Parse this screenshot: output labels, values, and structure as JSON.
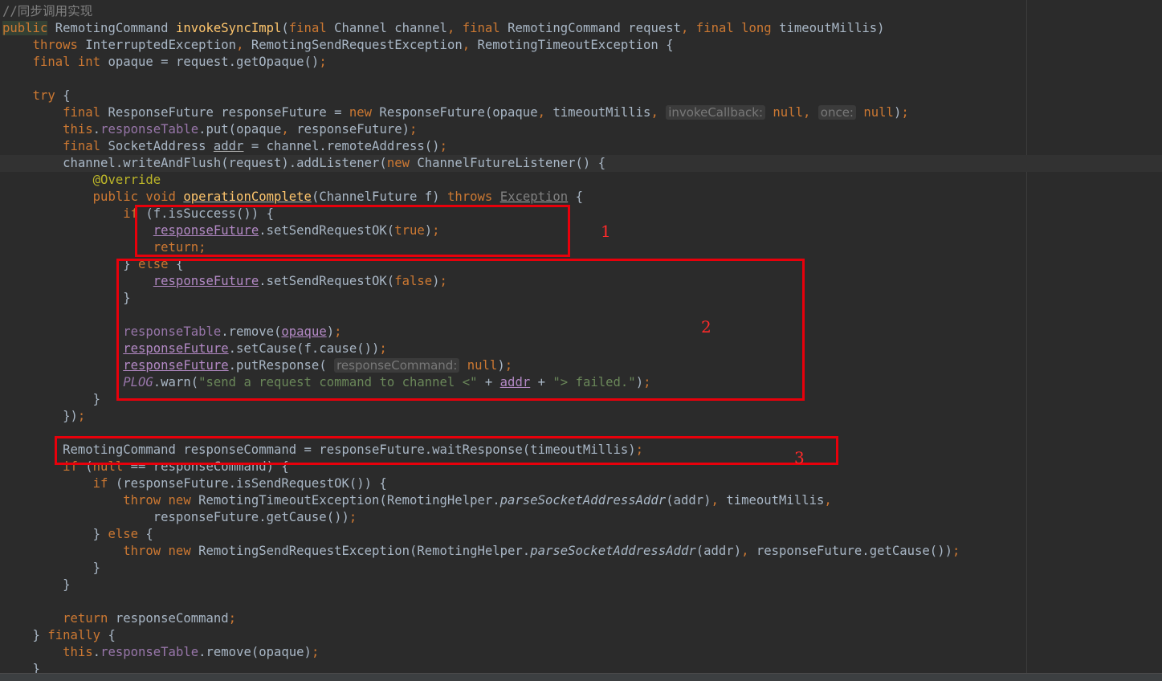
{
  "colors": {
    "background": "#2b2b2b",
    "keyword": "#cc7832",
    "method": "#ffc66d",
    "field": "#9876aa",
    "string": "#6a8759",
    "comment": "#808080",
    "annotation": "#bbb529",
    "highlight_box": "#e8000b"
  },
  "lines": [
    [
      {
        "t": "//同步调用实现",
        "c": "cmt"
      }
    ],
    [
      {
        "t": "public",
        "c": "kw kwbg"
      },
      {
        "t": " RemotingCommand "
      },
      {
        "t": "invokeSyncImpl",
        "c": "fn"
      },
      {
        "t": "("
      },
      {
        "t": "final",
        "c": "kw"
      },
      {
        "t": " Channel channel"
      },
      {
        "t": ", ",
        "c": "kw"
      },
      {
        "t": "final",
        "c": "kw"
      },
      {
        "t": " RemotingCommand request"
      },
      {
        "t": ", ",
        "c": "kw"
      },
      {
        "t": "final long",
        "c": "kw"
      },
      {
        "t": " timeoutMillis)"
      }
    ],
    [
      {
        "t": "    "
      },
      {
        "t": "throws",
        "c": "kw"
      },
      {
        "t": " InterruptedException"
      },
      {
        "t": ", ",
        "c": "kw"
      },
      {
        "t": "RemotingSendRequestException"
      },
      {
        "t": ", ",
        "c": "kw"
      },
      {
        "t": "RemotingTimeoutException {"
      }
    ],
    [
      {
        "t": "    "
      },
      {
        "t": "final int",
        "c": "kw"
      },
      {
        "t": " opaque = request.getOpaque()"
      },
      {
        "t": ";",
        "c": "kw"
      }
    ],
    [],
    [
      {
        "t": "    "
      },
      {
        "t": "try",
        "c": "kw"
      },
      {
        "t": " {"
      }
    ],
    [
      {
        "t": "        "
      },
      {
        "t": "final",
        "c": "kw"
      },
      {
        "t": " ResponseFuture responseFuture = "
      },
      {
        "t": "new",
        "c": "kw"
      },
      {
        "t": " ResponseFuture(opaque"
      },
      {
        "t": ", ",
        "c": "kw"
      },
      {
        "t": "timeoutMillis"
      },
      {
        "t": ", ",
        "c": "kw"
      },
      {
        "t": "invokeCallback:",
        "c": "hint"
      },
      {
        "t": " "
      },
      {
        "t": "null",
        "c": "kw"
      },
      {
        "t": ", ",
        "c": "kw"
      },
      {
        "t": "once:",
        "c": "hint"
      },
      {
        "t": " "
      },
      {
        "t": "null",
        "c": "kw"
      },
      {
        "t": ")"
      },
      {
        "t": ";",
        "c": "kw"
      }
    ],
    [
      {
        "t": "        "
      },
      {
        "t": "this",
        "c": "kw"
      },
      {
        "t": "."
      },
      {
        "t": "responseTable",
        "c": "fld"
      },
      {
        "t": ".put(opaque"
      },
      {
        "t": ", ",
        "c": "kw"
      },
      {
        "t": "responseFuture)"
      },
      {
        "t": ";",
        "c": "kw"
      }
    ],
    [
      {
        "t": "        "
      },
      {
        "t": "final",
        "c": "kw"
      },
      {
        "t": " SocketAddress "
      },
      {
        "t": "addr",
        "c": "ul"
      },
      {
        "t": " = channel.remoteAddress()"
      },
      {
        "t": ";",
        "c": "kw"
      }
    ],
    [
      {
        "t": "        channel.writeAndFlush(request).addListener("
      },
      {
        "t": "new",
        "c": "kw"
      },
      {
        "t": " ChannelFutureListener() {"
      }
    ],
    [
      {
        "t": "            "
      },
      {
        "t": "@Override",
        "c": "ann"
      }
    ],
    [
      {
        "t": "            "
      },
      {
        "t": "public void",
        "c": "kw"
      },
      {
        "t": " "
      },
      {
        "t": "operationComplete",
        "c": "fn ul"
      },
      {
        "t": "(ChannelFuture f) "
      },
      {
        "t": "throws",
        "c": "kw"
      },
      {
        "t": " "
      },
      {
        "t": "Exception",
        "c": "cmt ul"
      },
      {
        "t": " {"
      }
    ],
    [
      {
        "t": "                "
      },
      {
        "t": "if",
        "c": "kw"
      },
      {
        "t": " (f.isSuccess()) {"
      }
    ],
    [
      {
        "t": "                    "
      },
      {
        "t": "responseFuture",
        "c": "var"
      },
      {
        "t": ".setSendRequestOK("
      },
      {
        "t": "true",
        "c": "kw"
      },
      {
        "t": ")"
      },
      {
        "t": ";",
        "c": "kw"
      }
    ],
    [
      {
        "t": "                    "
      },
      {
        "t": "return;",
        "c": "kw"
      }
    ],
    [
      {
        "t": "                } "
      },
      {
        "t": "else",
        "c": "kw"
      },
      {
        "t": " {"
      }
    ],
    [
      {
        "t": "                    "
      },
      {
        "t": "responseFuture",
        "c": "var"
      },
      {
        "t": ".setSendRequestOK("
      },
      {
        "t": "false",
        "c": "kw"
      },
      {
        "t": ")"
      },
      {
        "t": ";",
        "c": "kw"
      }
    ],
    [
      {
        "t": "                }"
      }
    ],
    [],
    [
      {
        "t": "                "
      },
      {
        "t": "responseTable",
        "c": "fld"
      },
      {
        "t": ".remove("
      },
      {
        "t": "opaque",
        "c": "var"
      },
      {
        "t": ")"
      },
      {
        "t": ";",
        "c": "kw"
      }
    ],
    [
      {
        "t": "                "
      },
      {
        "t": "responseFuture",
        "c": "var"
      },
      {
        "t": ".setCause(f.cause())"
      },
      {
        "t": ";",
        "c": "kw"
      }
    ],
    [
      {
        "t": "                "
      },
      {
        "t": "responseFuture",
        "c": "var"
      },
      {
        "t": ".putResponse( "
      },
      {
        "t": "responseCommand:",
        "c": "hint"
      },
      {
        "t": " "
      },
      {
        "t": "null",
        "c": "kw"
      },
      {
        "t": ")"
      },
      {
        "t": ";",
        "c": "kw"
      }
    ],
    [
      {
        "t": "                "
      },
      {
        "t": "PLOG",
        "c": "ital-fld"
      },
      {
        "t": ".warn("
      },
      {
        "t": "\"send a request command to channel <\"",
        "c": "str"
      },
      {
        "t": " + "
      },
      {
        "t": "addr",
        "c": "var"
      },
      {
        "t": " + "
      },
      {
        "t": "\"> failed.\"",
        "c": "str"
      },
      {
        "t": ")"
      },
      {
        "t": ";",
        "c": "kw"
      }
    ],
    [
      {
        "t": "            }"
      }
    ],
    [
      {
        "t": "        })"
      },
      {
        "t": ";",
        "c": "kw"
      }
    ],
    [],
    [
      {
        "t": "        RemotingCommand responseCommand = responseFuture.waitResponse(timeoutMillis)"
      },
      {
        "t": ";",
        "c": "kw"
      }
    ],
    [
      {
        "t": "        "
      },
      {
        "t": "if",
        "c": "kw"
      },
      {
        "t": " ("
      },
      {
        "t": "null",
        "c": "kw"
      },
      {
        "t": " == responseCommand) {"
      }
    ],
    [
      {
        "t": "            "
      },
      {
        "t": "if",
        "c": "kw"
      },
      {
        "t": " (responseFuture.isSendRequestOK()) {"
      }
    ],
    [
      {
        "t": "                "
      },
      {
        "t": "throw new",
        "c": "kw"
      },
      {
        "t": " RemotingTimeoutException(RemotingHelper."
      },
      {
        "t": "parseSocketAddressAddr",
        "c": "it"
      },
      {
        "t": "(addr)"
      },
      {
        "t": ", ",
        "c": "kw"
      },
      {
        "t": "timeoutMillis"
      },
      {
        "t": ",",
        "c": "kw"
      }
    ],
    [
      {
        "t": "                    responseFuture.getCause())"
      },
      {
        "t": ";",
        "c": "kw"
      }
    ],
    [
      {
        "t": "            } "
      },
      {
        "t": "else",
        "c": "kw"
      },
      {
        "t": " {"
      }
    ],
    [
      {
        "t": "                "
      },
      {
        "t": "throw new",
        "c": "kw"
      },
      {
        "t": " RemotingSendRequestException(RemotingHelper."
      },
      {
        "t": "parseSocketAddressAddr",
        "c": "it"
      },
      {
        "t": "(addr)"
      },
      {
        "t": ", ",
        "c": "kw"
      },
      {
        "t": "responseFuture.getCause())"
      },
      {
        "t": ";",
        "c": "kw"
      }
    ],
    [
      {
        "t": "            }"
      }
    ],
    [
      {
        "t": "        }"
      }
    ],
    [],
    [
      {
        "t": "        "
      },
      {
        "t": "return",
        "c": "kw"
      },
      {
        "t": " responseCommand"
      },
      {
        "t": ";",
        "c": "kw"
      }
    ],
    [
      {
        "t": "    } "
      },
      {
        "t": "finally",
        "c": "kw"
      },
      {
        "t": " {"
      }
    ],
    [
      {
        "t": "        "
      },
      {
        "t": "this",
        "c": "kw"
      },
      {
        "t": "."
      },
      {
        "t": "responseTable",
        "c": "fld"
      },
      {
        "t": ".remove(opaque)"
      },
      {
        "t": ";",
        "c": "kw"
      }
    ],
    [
      {
        "t": "    }"
      }
    ]
  ],
  "annotations": [
    {
      "label": "1"
    },
    {
      "label": "2"
    },
    {
      "label": "3"
    }
  ]
}
